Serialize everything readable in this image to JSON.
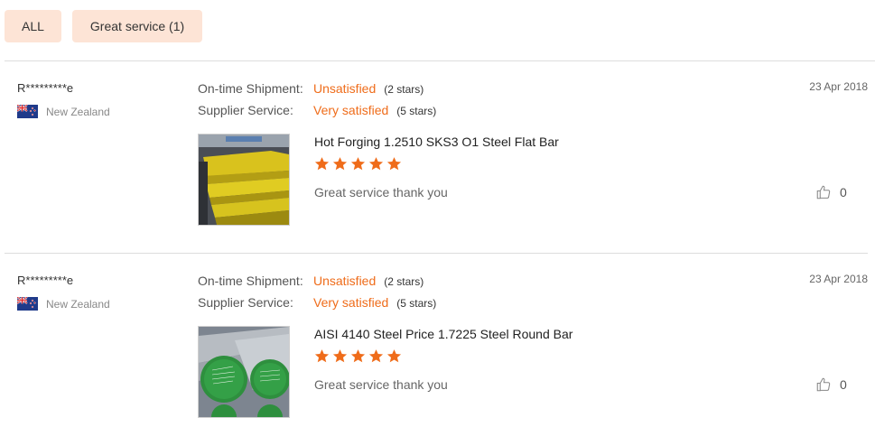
{
  "filters": [
    {
      "label": "ALL"
    },
    {
      "label": "Great service (1)"
    }
  ],
  "colors": {
    "accent": "#ef6c1a",
    "filter_bg": "#fde4d6",
    "divider": "#dddddd"
  },
  "reviews": [
    {
      "reviewer": "R*********e",
      "country": "New Zealand",
      "flag_icon": "new-zealand-flag-icon",
      "shipment_label": "On-time Shipment:",
      "shipment_value": "Unsatisfied",
      "shipment_stars": "(2 stars)",
      "service_label": "Supplier Service:",
      "service_value": "Very satisfied",
      "service_stars": "(5 stars)",
      "date": "23 Apr 2018",
      "product_title": "Hot Forging 1.2510 SKS3 O1 Steel Flat Bar",
      "product_rating": 5,
      "comment": "Great service thank you",
      "likes": "0"
    },
    {
      "reviewer": "R*********e",
      "country": "New Zealand",
      "flag_icon": "new-zealand-flag-icon",
      "shipment_label": "On-time Shipment:",
      "shipment_value": "Unsatisfied",
      "shipment_stars": "(2 stars)",
      "service_label": "Supplier Service:",
      "service_value": "Very satisfied",
      "service_stars": "(5 stars)",
      "date": "23 Apr 2018",
      "product_title": "AISI 4140 Steel Price 1.7225 Steel Round Bar",
      "product_rating": 5,
      "comment": "Great service thank you",
      "likes": "0"
    }
  ]
}
